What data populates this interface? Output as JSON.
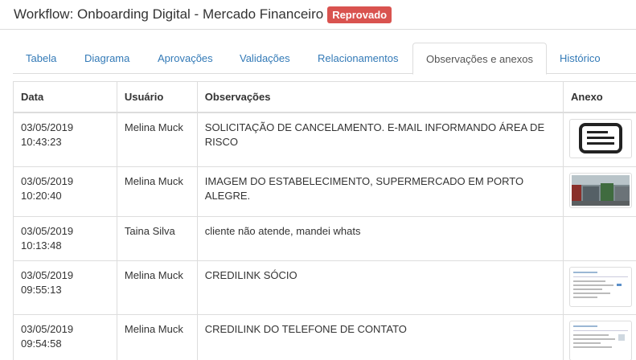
{
  "header": {
    "title": "Workflow: Onboarding Digital - Mercado Financeiro",
    "status_badge": "Reprovado"
  },
  "tabs": [
    {
      "label": "Tabela",
      "active": false
    },
    {
      "label": "Diagrama",
      "active": false
    },
    {
      "label": "Aprovações",
      "active": false
    },
    {
      "label": "Validações",
      "active": false
    },
    {
      "label": "Relacionamentos",
      "active": false
    },
    {
      "label": "Observações e anexos",
      "active": true
    },
    {
      "label": "Histórico",
      "active": false
    }
  ],
  "table": {
    "columns": [
      "Data",
      "Usuário",
      "Observações",
      "Anexo"
    ],
    "rows": [
      {
        "date": "03/05/2019",
        "time": "10:43:23",
        "user": "Melina Muck",
        "obs": "SOLICITAÇÃO DE CANCELAMENTO. E-MAIL INFORMANDO ÁREA DE RISCO",
        "attachment": "document-icon"
      },
      {
        "date": "03/05/2019",
        "time": "10:20:40",
        "user": "Melina Muck",
        "obs": "IMAGEM DO ESTABELECIMENTO, SUPERMERCADO EM PORTO ALEGRE.",
        "attachment": "photo-thumbnail"
      },
      {
        "date": "03/05/2019",
        "time": "10:13:48",
        "user": "Taina Silva",
        "obs": "cliente não atende, mandei whats",
        "attachment": ""
      },
      {
        "date": "03/05/2019",
        "time": "09:55:13",
        "user": "Melina Muck",
        "obs": "CREDILINK SÓCIO",
        "attachment": "screenshot-thumbnail"
      },
      {
        "date": "03/05/2019",
        "time": "09:54:58",
        "user": "Melina Muck",
        "obs": "CREDILINK DO TELEFONE DE CONTATO",
        "attachment": "screenshot-thumbnail"
      }
    ]
  },
  "colors": {
    "badge": "#d9534f",
    "link": "#337ab7",
    "border": "#dddddd"
  }
}
